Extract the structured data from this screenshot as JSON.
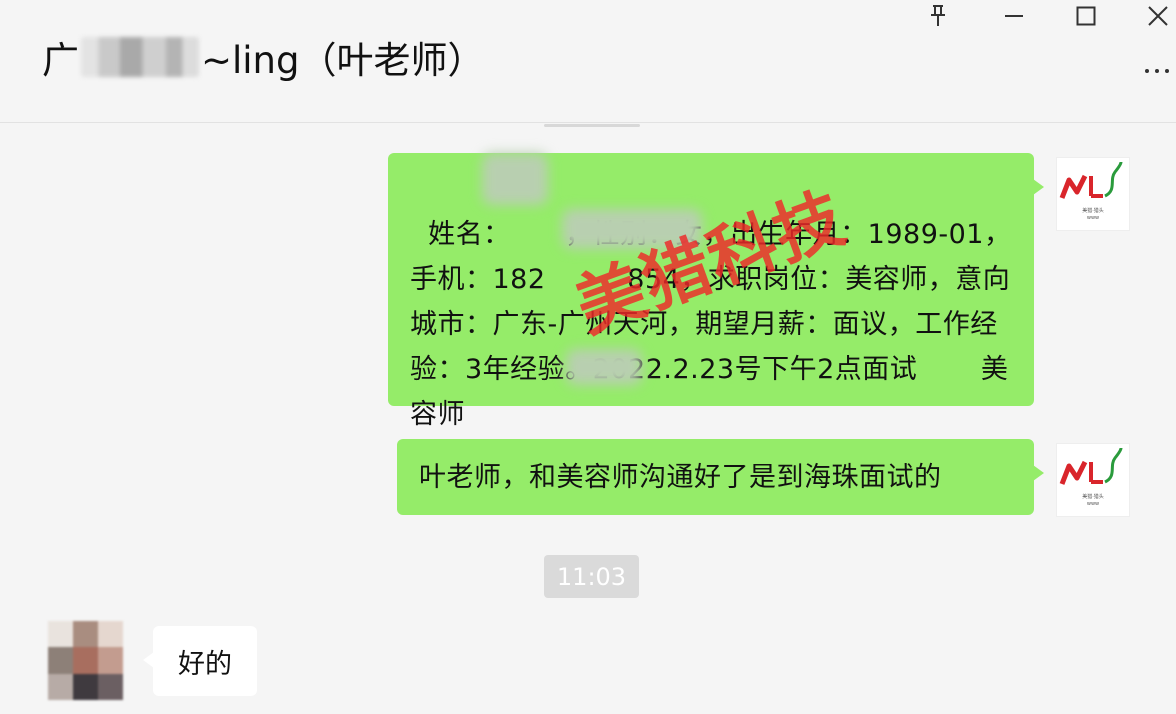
{
  "header": {
    "title_prefix": "广",
    "title_suffix": "~ling（叶老师）"
  },
  "window_controls": [
    "pin-icon",
    "minimize-icon",
    "maximize-icon",
    "close-icon"
  ],
  "messages": [
    {
      "direction": "out",
      "text": "姓名：      ，性别：女，出生年月：1989-01，手机：182         854，求职岗位：美容师，意向城市：广东-广州天河，期望月薪：面议，工作经验：3年经验。2022.2.23号下午2点面试       美容师"
    },
    {
      "direction": "out",
      "text": "叶老师，和美容师沟通好了是到海珠面试的"
    }
  ],
  "timestamp": "11:03",
  "incoming": {
    "text": "好的"
  },
  "watermark": "美猎科技",
  "accent_colors": {
    "bubble_out": "#95ec69",
    "bubble_in": "#ffffff",
    "watermark": "#ee2828",
    "logo_red": "#d9252b",
    "logo_green": "#2a9b3c"
  }
}
